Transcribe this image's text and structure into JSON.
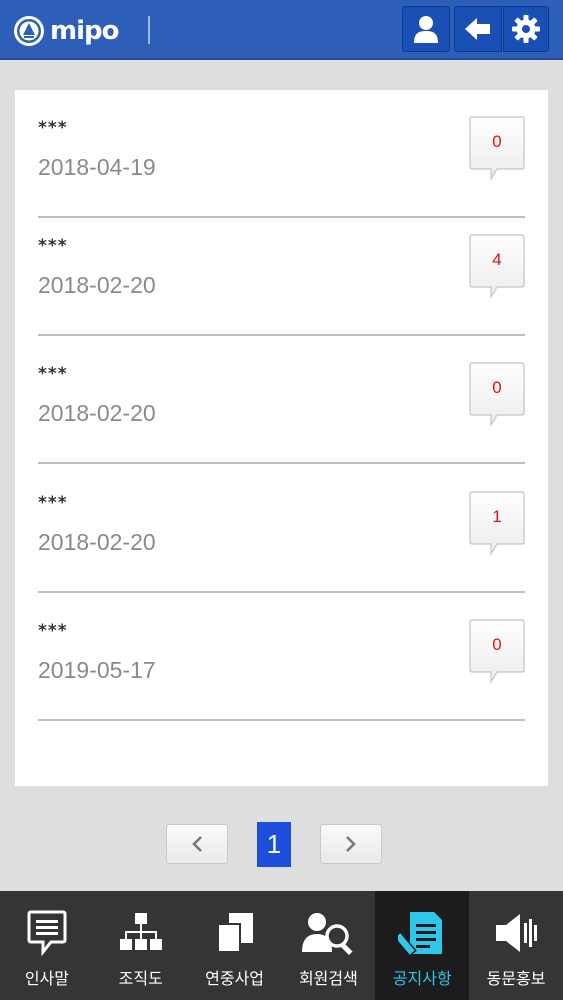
{
  "header": {
    "logo_text": "mipo",
    "accent": "#2d5fb8",
    "buttons": [
      {
        "icon": "user-icon"
      },
      {
        "icon": "back-arrow-icon"
      },
      {
        "icon": "gear-icon"
      }
    ]
  },
  "notices": [
    {
      "title": "***",
      "date": "2018-04-19",
      "comments": "0"
    },
    {
      "title": "***",
      "date": "2018-02-20",
      "comments": "4"
    },
    {
      "title": "***",
      "date": "2018-02-20",
      "comments": "0"
    },
    {
      "title": "***",
      "date": "2018-02-20",
      "comments": "1"
    },
    {
      "title": "***",
      "date": "2019-05-17",
      "comments": "0"
    }
  ],
  "pagination": {
    "current": "1",
    "prev_icon": "chevron-left-icon",
    "next_icon": "chevron-right-icon"
  },
  "bottom_nav": {
    "active_color": "#2fc6ea",
    "items": [
      {
        "label": "인사말",
        "icon": "speech-bubble-icon",
        "active": false
      },
      {
        "label": "조직도",
        "icon": "org-chart-icon",
        "active": false
      },
      {
        "label": "연중사업",
        "icon": "documents-icon",
        "active": false
      },
      {
        "label": "회원검색",
        "icon": "member-search-icon",
        "active": false
      },
      {
        "label": "공지사항",
        "icon": "notice-edit-icon",
        "active": true
      },
      {
        "label": "동문홍보",
        "icon": "speaker-icon",
        "active": false
      }
    ]
  }
}
